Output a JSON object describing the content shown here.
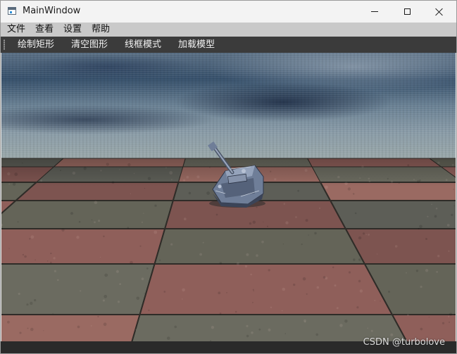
{
  "window": {
    "title": "MainWindow",
    "icon": "app-window-icon"
  },
  "menu": {
    "items": [
      "文件",
      "查看",
      "设置",
      "帮助"
    ]
  },
  "toolbar": {
    "buttons": [
      "绘制矩形",
      "清空图形",
      "线框模式",
      "加载模型"
    ]
  },
  "scene": {
    "background": "water-skybox",
    "floor": "checkerboard-tiles",
    "model": "tank-model"
  },
  "watermark": "CSDN @turbolove"
}
